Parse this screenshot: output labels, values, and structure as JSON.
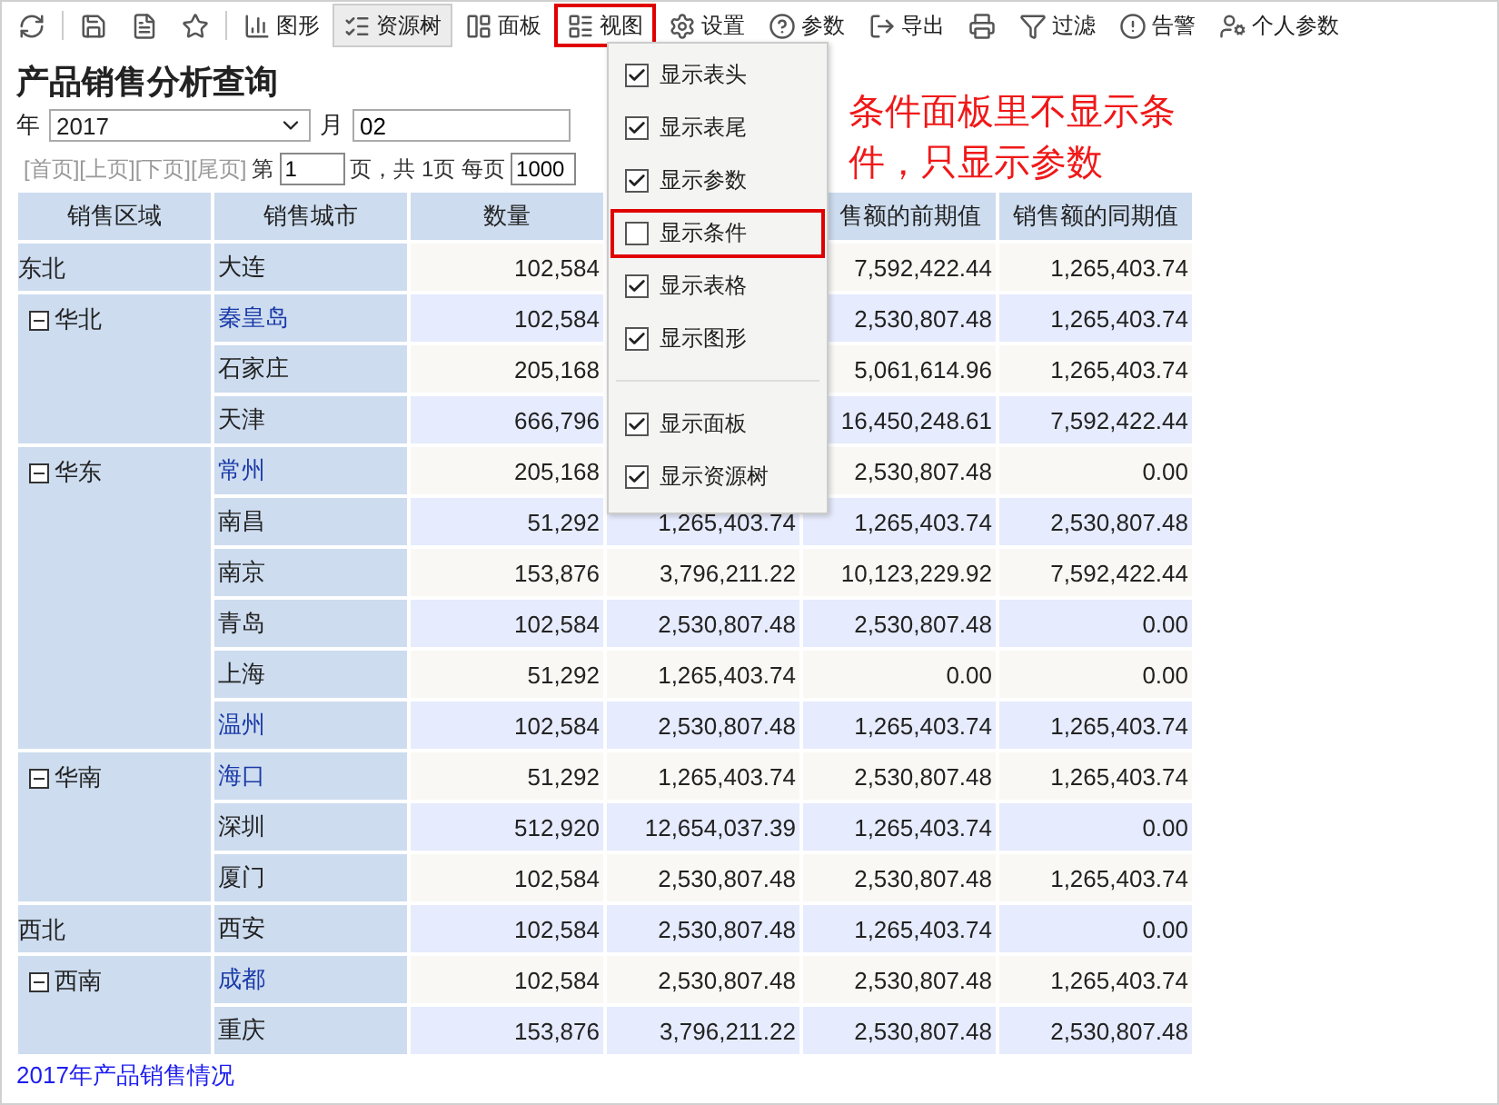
{
  "toolbar": [
    {
      "selected": false,
      "highlighted": false
    },
    {
      "selected": false,
      "highlighted": false
    },
    {
      "selected": false,
      "highlighted": false
    },
    {
      "selected": false,
      "highlighted": false
    },
    {
      "label": "图形",
      "selected": false,
      "highlighted": false
    },
    {
      "label": "资源树",
      "selected": true,
      "highlighted": false
    },
    {
      "label": "面板",
      "selected": false,
      "highlighted": false
    },
    {
      "label": "视图",
      "selected": false,
      "highlighted": true
    },
    {
      "label": "设置",
      "selected": false,
      "highlighted": false
    },
    {
      "label": "参数",
      "selected": false,
      "highlighted": false
    },
    {
      "label": "导出",
      "selected": false,
      "highlighted": false
    },
    {
      "selected": false,
      "highlighted": false
    },
    {
      "label": "过滤",
      "selected": false,
      "highlighted": false
    },
    {
      "label": "告警",
      "selected": false,
      "highlighted": false
    },
    {
      "label": "个人参数",
      "selected": false,
      "highlighted": false
    }
  ],
  "title": "产品销售分析查询",
  "params": {
    "year_label": "年",
    "year_value": "2017",
    "month_label": "月",
    "month_value": "02"
  },
  "paging": {
    "links": [
      "[首页]",
      "[上页]",
      "[下页]",
      "[尾页]"
    ],
    "page_prefix": "第",
    "page_value": "1",
    "page_suffix": "页，共 1页 每页",
    "size_value": "1000"
  },
  "view_menu": {
    "sections": [
      [
        {
          "label": "显示表头",
          "checked": true,
          "highlighted": false
        },
        {
          "label": "显示表尾",
          "checked": true,
          "highlighted": false
        },
        {
          "label": "显示参数",
          "checked": true,
          "highlighted": false
        },
        {
          "label": "显示条件",
          "checked": false,
          "highlighted": true
        },
        {
          "label": "显示表格",
          "checked": true,
          "highlighted": false
        },
        {
          "label": "显示图形",
          "checked": true,
          "highlighted": false
        }
      ],
      [
        {
          "label": "显示面板",
          "checked": true,
          "highlighted": false
        },
        {
          "label": "显示资源树",
          "checked": true,
          "highlighted": false
        }
      ]
    ]
  },
  "annotation": "条件面板里不显示条件，只显示参数",
  "table": {
    "columns": [
      "销售区域",
      "销售城市",
      "数量"
    ],
    "right_columns": [
      "售额的前期值",
      "销售额的同期值"
    ],
    "regions": [
      {
        "name": "东北",
        "kind": "leaf",
        "rows": [
          {
            "city": "大连",
            "quantity": "102,584",
            "prior": "7,592,422.44",
            "same_period": "1,265,403.74"
          }
        ]
      },
      {
        "name": "华北",
        "kind": "group",
        "expanded": true,
        "rows": [
          {
            "city": "秦皇岛",
            "quantity": "102,584",
            "prior": "2,530,807.48",
            "same_period": "1,265,403.74"
          },
          {
            "city": "石家庄",
            "quantity": "205,168",
            "prior": "5,061,614.96",
            "same_period": "1,265,403.74"
          },
          {
            "city": "天津",
            "quantity": "666,796",
            "prior": "16,450,248.61",
            "same_period": "7,592,422.44"
          }
        ]
      },
      {
        "name": "华东",
        "kind": "group",
        "expanded": true,
        "rows": [
          {
            "city": "常州",
            "quantity": "205,168",
            "prior": "2,530,807.48",
            "same_period": "0.00"
          },
          {
            "city": "南昌",
            "quantity": "51,292",
            "column_4": "1,265,403.74",
            "prior": "1,265,403.74",
            "same_period": "2,530,807.48"
          },
          {
            "city": "南京",
            "quantity": "153,876",
            "column_4": "3,796,211.22",
            "prior": "10,123,229.92",
            "same_period": "7,592,422.44"
          },
          {
            "city": "青岛",
            "quantity": "102,584",
            "column_4": "2,530,807.48",
            "prior": "2,530,807.48",
            "same_period": "0.00"
          },
          {
            "city": "上海",
            "quantity": "51,292",
            "column_4": "1,265,403.74",
            "prior": "0.00",
            "same_period": "0.00"
          },
          {
            "city": "温州",
            "quantity": "102,584",
            "column_4": "2,530,807.48",
            "prior": "1,265,403.74",
            "same_period": "1,265,403.74"
          }
        ]
      },
      {
        "name": "华南",
        "kind": "group",
        "expanded": true,
        "rows": [
          {
            "city": "海口",
            "quantity": "51,292",
            "column_4": "1,265,403.74",
            "prior": "2,530,807.48",
            "same_period": "1,265,403.74"
          },
          {
            "city": "深圳",
            "quantity": "512,920",
            "column_4": "12,654,037.39",
            "prior": "1,265,403.74",
            "same_period": "0.00"
          },
          {
            "city": "厦门",
            "quantity": "102,584",
            "column_4": "2,530,807.48",
            "prior": "2,530,807.48",
            "same_period": "1,265,403.74"
          }
        ]
      },
      {
        "name": "西北",
        "kind": "leaf",
        "rows": [
          {
            "city": "西安",
            "quantity": "102,584",
            "column_4": "2,530,807.48",
            "prior": "1,265,403.74",
            "same_period": "0.00"
          }
        ]
      },
      {
        "name": "西南",
        "kind": "group",
        "expanded": true,
        "rows": [
          {
            "city": "成都",
            "quantity": "102,584",
            "column_4": "2,530,807.48",
            "prior": "2,530,807.48",
            "same_period": "1,265,403.74"
          },
          {
            "city": "重庆",
            "quantity": "153,876",
            "column_4": "3,796,211.22",
            "prior": "2,530,807.48",
            "same_period": "2,530,807.48"
          }
        ]
      }
    ]
  },
  "footer_link": "2017年产品销售情况"
}
